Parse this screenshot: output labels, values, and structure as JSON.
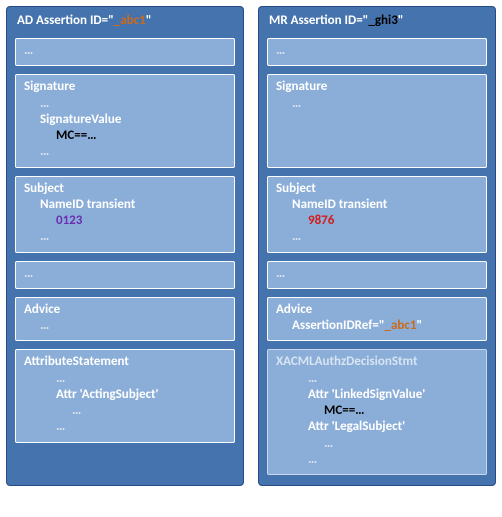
{
  "ellipsis": "…",
  "left": {
    "title_prefix": "AD Assertion  ID=\"",
    "title_id": "_abc1",
    "title_suffix": "\"",
    "signature": {
      "header": "Signature",
      "sigvalue_label": "SignatureValue",
      "sigvalue": "MC==…"
    },
    "subject": {
      "header": "Subject",
      "nameid_label": "NameID transient",
      "nameid_value": "0123"
    },
    "advice": {
      "header": "Advice"
    },
    "attrstmt": {
      "header": "AttributeStatement",
      "attr1": "Attr 'ActingSubject'"
    }
  },
  "right": {
    "title_prefix": "MR Assertion  ID=\"",
    "title_id": "_ghi3",
    "title_suffix": "\"",
    "signature": {
      "header": "Signature"
    },
    "subject": {
      "header": "Subject",
      "nameid_label": "NameID transient",
      "nameid_value": "9876"
    },
    "advice": {
      "header": "Advice",
      "ref_label_prefix": "AssertionIDRef=\"",
      "ref_value": "_abc1",
      "ref_label_suffix": "\""
    },
    "xacml": {
      "header": "XACMLAuthzDecisionStmt",
      "attr_linked": "Attr 'LinkedSignValue'",
      "linked_value": "MC==…",
      "attr_legal": "Attr 'LegalSubject'"
    }
  }
}
